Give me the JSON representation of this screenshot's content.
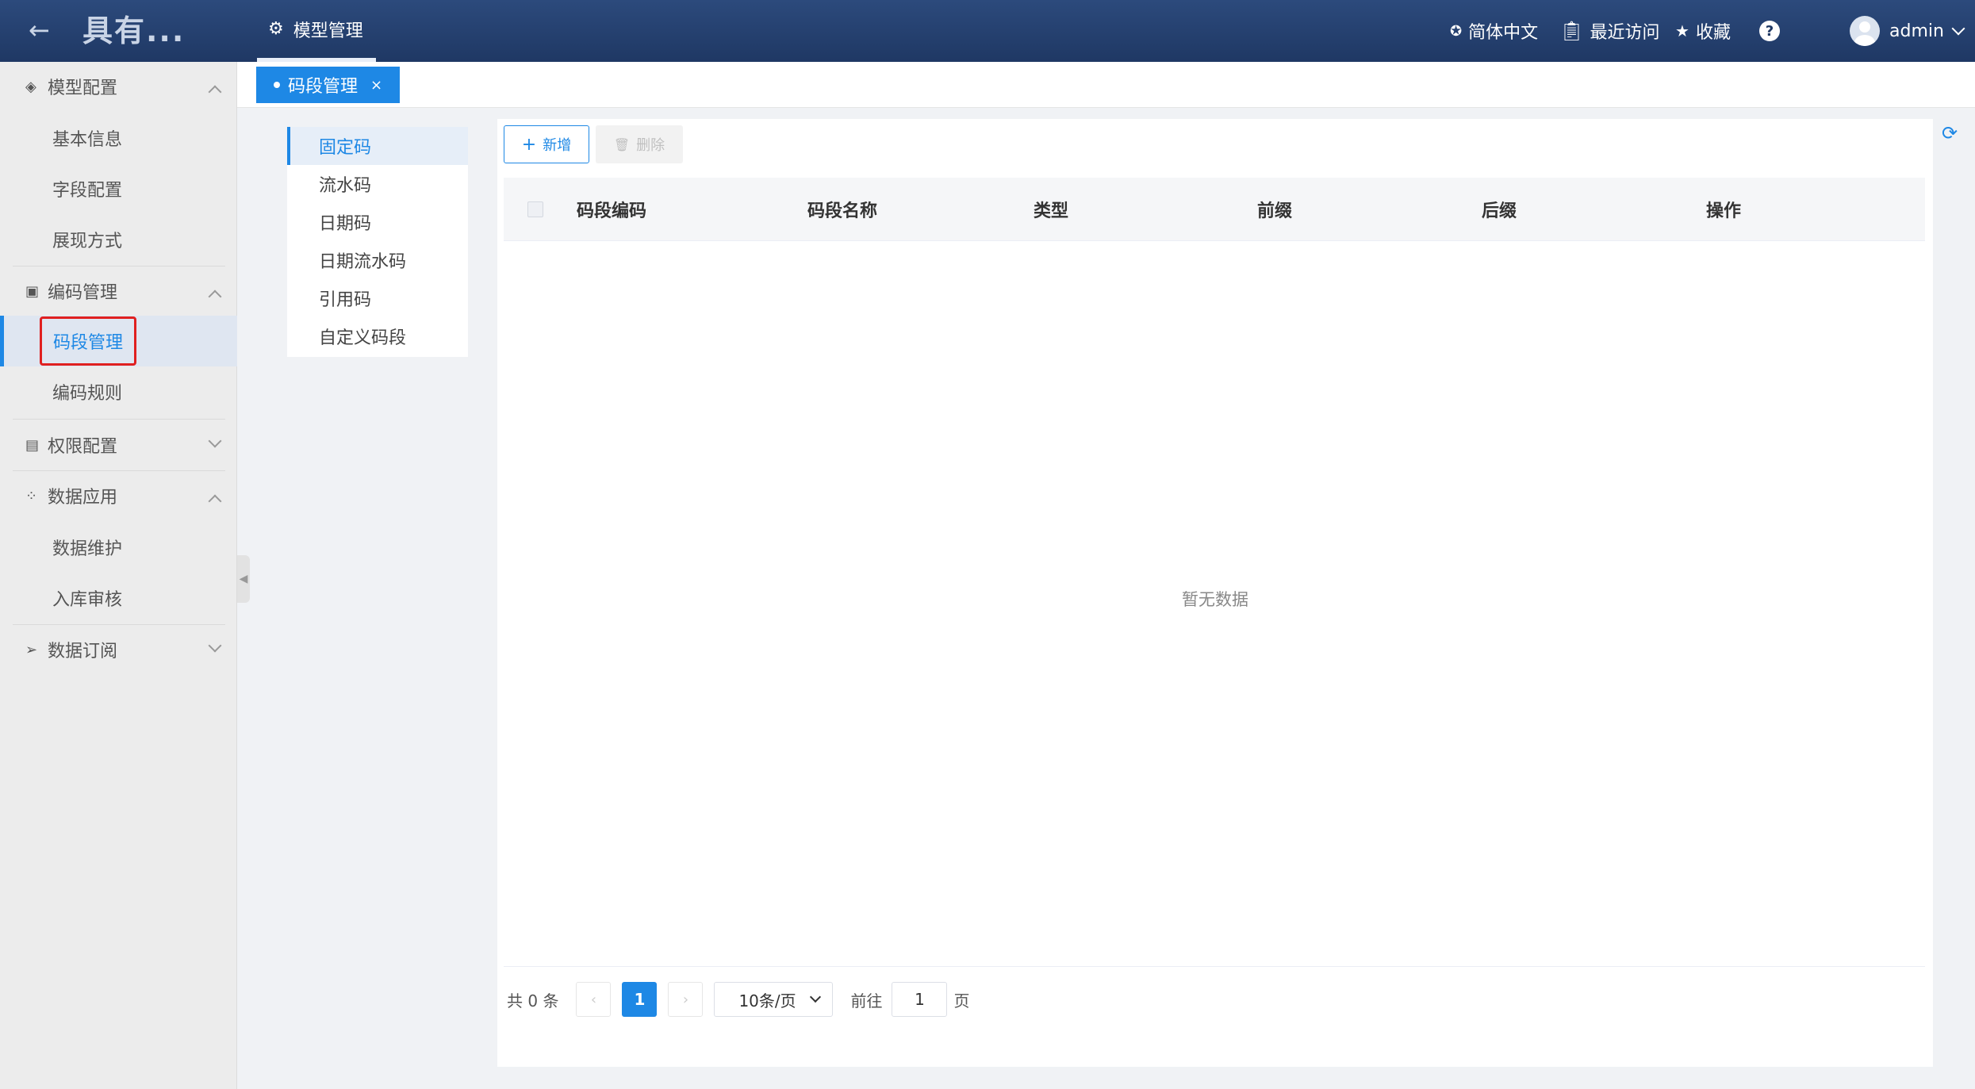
{
  "header": {
    "app_title": "具有...",
    "top_tab_label": "模型管理",
    "language": "简体中文",
    "recent": "最近访问",
    "favorites": "收藏",
    "help": "?",
    "user": "admin"
  },
  "sidebar": {
    "groups": [
      {
        "label": "模型配置",
        "icon": "layers-icon",
        "expanded": true
      },
      {
        "label": "编码管理",
        "icon": "chart-icon",
        "expanded": true
      },
      {
        "label": "权限配置",
        "icon": "permission-icon",
        "expanded": false
      },
      {
        "label": "数据应用",
        "icon": "apps-icon",
        "expanded": true
      },
      {
        "label": "数据订阅",
        "icon": "send-icon",
        "expanded": false
      }
    ],
    "items": {
      "basic_info": "基本信息",
      "field_config": "字段配置",
      "display_mode": "展现方式",
      "segment_mgmt": "码段管理",
      "code_rules": "编码规则",
      "data_maintain": "数据维护",
      "storage_review": "入库审核"
    },
    "active_item": "码段管理"
  },
  "tabbar": {
    "active_tab": "码段管理",
    "close": "×"
  },
  "subnav": {
    "items": [
      "固定码",
      "流水码",
      "日期码",
      "日期流水码",
      "引用码",
      "自定义码段"
    ],
    "active": "固定码"
  },
  "toolbar": {
    "add_label": "新增",
    "delete_label": "删除"
  },
  "table": {
    "columns": [
      "码段编码",
      "码段名称",
      "类型",
      "前缀",
      "后缀",
      "操作"
    ],
    "rows": [],
    "empty_text": "暂无数据"
  },
  "pagination": {
    "total_text": "共 0 条",
    "current_page": "1",
    "page_size": "10条/页",
    "goto_prefix": "前往",
    "goto_value": "1",
    "goto_suffix": "页"
  },
  "colors": {
    "header_bg": "#1f3864",
    "accent": "#1e88e5",
    "highlight_border": "#e02020"
  }
}
